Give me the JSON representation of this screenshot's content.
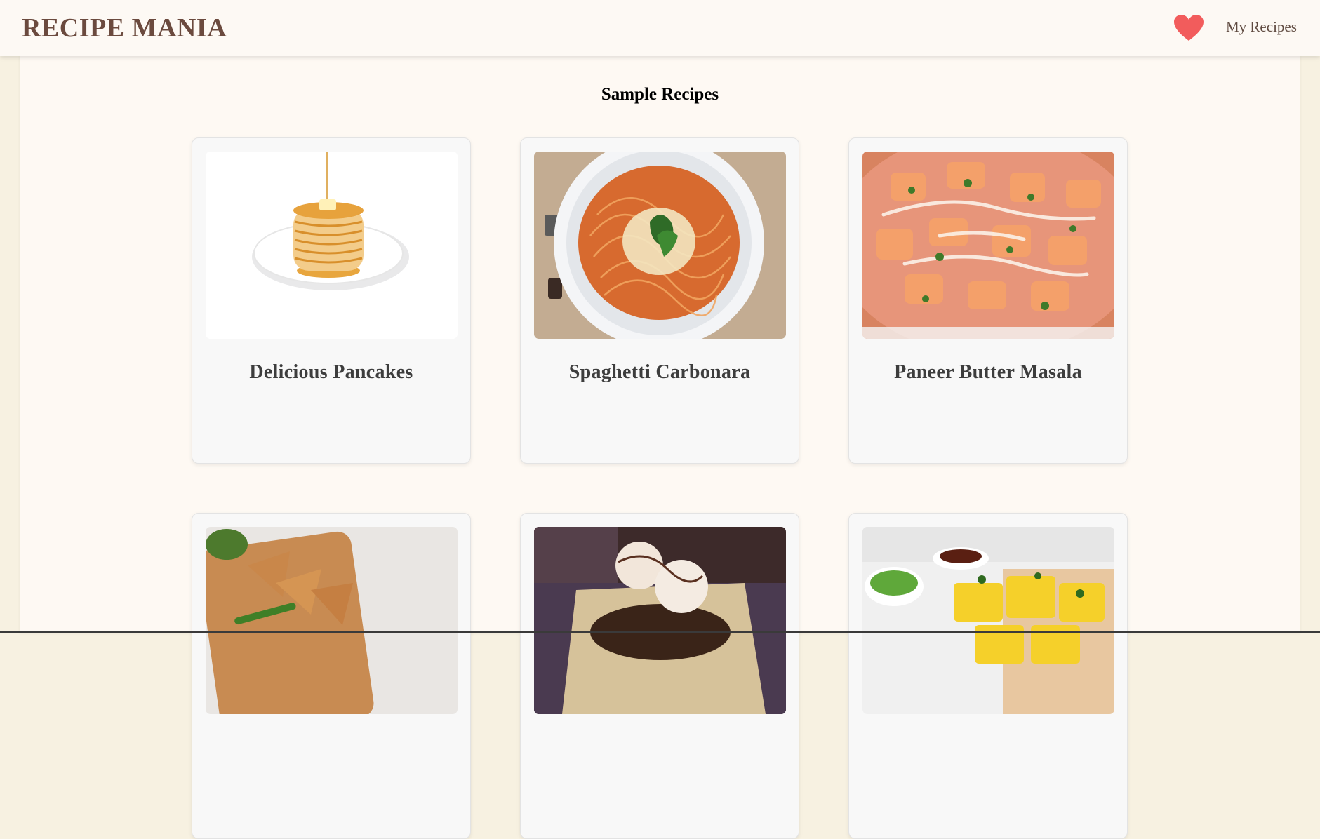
{
  "header": {
    "brand": "RECIPE MANIA",
    "favorites_icon": "heart-icon",
    "my_recipes_label": "My Recipes"
  },
  "main": {
    "section_title": "Sample Recipes",
    "recipes": [
      {
        "title": "Delicious Pancakes",
        "image": "pancakes-image"
      },
      {
        "title": "Spaghetti Carbonara",
        "image": "spaghetti-image"
      },
      {
        "title": "Paneer Butter Masala",
        "image": "paneer-image"
      },
      {
        "title": "",
        "image": "samosa-image"
      },
      {
        "title": "",
        "image": "dessert-image"
      },
      {
        "title": "",
        "image": "dhokla-image"
      }
    ]
  },
  "colors": {
    "brand": "#6b4a3e",
    "heart": "#f25c5c",
    "page_bg": "#fef9f3",
    "card_bg": "#f8f8f8"
  }
}
